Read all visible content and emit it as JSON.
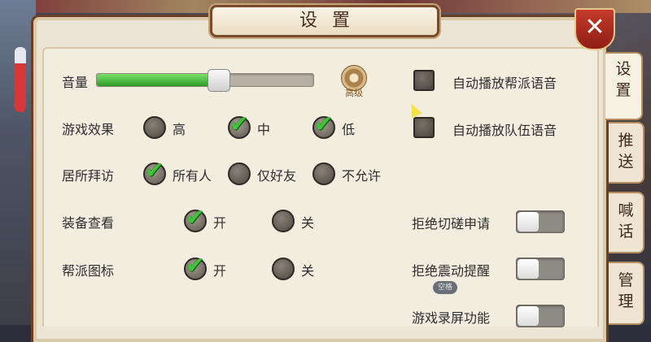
{
  "dialog": {
    "title": "设置",
    "close_label": "✕"
  },
  "tabs": [
    {
      "chars": [
        "设",
        "置"
      ],
      "active": true
    },
    {
      "chars": [
        "推",
        "送"
      ],
      "active": false
    },
    {
      "chars": [
        "喊",
        "话"
      ],
      "active": false
    },
    {
      "chars": [
        "管",
        "理"
      ],
      "active": false
    }
  ],
  "volume": {
    "label": "音量",
    "level_fraction": 0.56,
    "advanced_label": "高级"
  },
  "effects": {
    "label": "游戏效果",
    "options": [
      {
        "label": "高",
        "checked": false
      },
      {
        "label": "中",
        "checked": true
      },
      {
        "label": "低",
        "checked": true
      }
    ]
  },
  "visit": {
    "label": "居所拜访",
    "options": [
      {
        "label": "所有人",
        "checked": true
      },
      {
        "label": "仅好友",
        "checked": false
      },
      {
        "label": "不允许",
        "checked": false
      }
    ]
  },
  "equipment_view": {
    "label": "装备查看",
    "options": [
      {
        "label": "开",
        "checked": true
      },
      {
        "label": "关",
        "checked": false
      }
    ]
  },
  "guild_icon": {
    "label": "帮派图标",
    "options": [
      {
        "label": "开",
        "checked": true
      },
      {
        "label": "关",
        "checked": false
      }
    ]
  },
  "autoplay": [
    {
      "label": "自动播放帮派语音",
      "checked": false
    },
    {
      "label": "自动播放队伍语音",
      "checked": false
    }
  ],
  "toggles": [
    {
      "label": "拒绝切磋申请",
      "on": false
    },
    {
      "label": "拒绝震动提醒",
      "on": false
    },
    {
      "label": "游戏录屏功能",
      "on": false
    }
  ],
  "chip_label": "空格",
  "colors": {
    "accent_green": "#40c43a",
    "close_red": "#c63b2b",
    "frame_brown": "#6b3f26"
  }
}
